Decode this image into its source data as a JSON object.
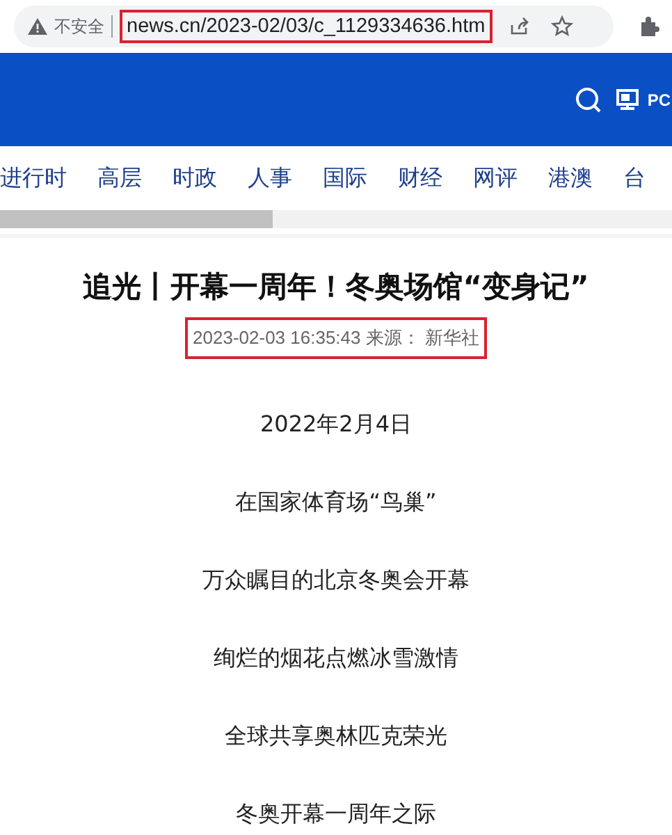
{
  "browser": {
    "security_label": "不安全",
    "url": "news.cn/2023-02/03/c_1129334636.htm",
    "url_highlighted": true
  },
  "header": {
    "pc_label": "PC"
  },
  "nav": [
    {
      "label": "进行时"
    },
    {
      "label": "高层"
    },
    {
      "label": "时政"
    },
    {
      "label": "人事"
    },
    {
      "label": "国际"
    },
    {
      "label": "财经"
    },
    {
      "label": "网评"
    },
    {
      "label": "港澳"
    },
    {
      "label": "台"
    }
  ],
  "article": {
    "title": "追光丨开幕一周年！冬奥场馆“变身记”",
    "meta": "2023-02-03 16:35:43 来源： 新华社",
    "meta_highlighted": true,
    "paragraphs": [
      "2022年2月4日",
      "在国家体育场“鸟巢”",
      "万众瞩目的北京冬奥会开幕",
      "绚烂的烟花点燃冰雪激情",
      "全球共享奥林匹克荣光",
      "冬奥开幕一周年之际"
    ]
  }
}
